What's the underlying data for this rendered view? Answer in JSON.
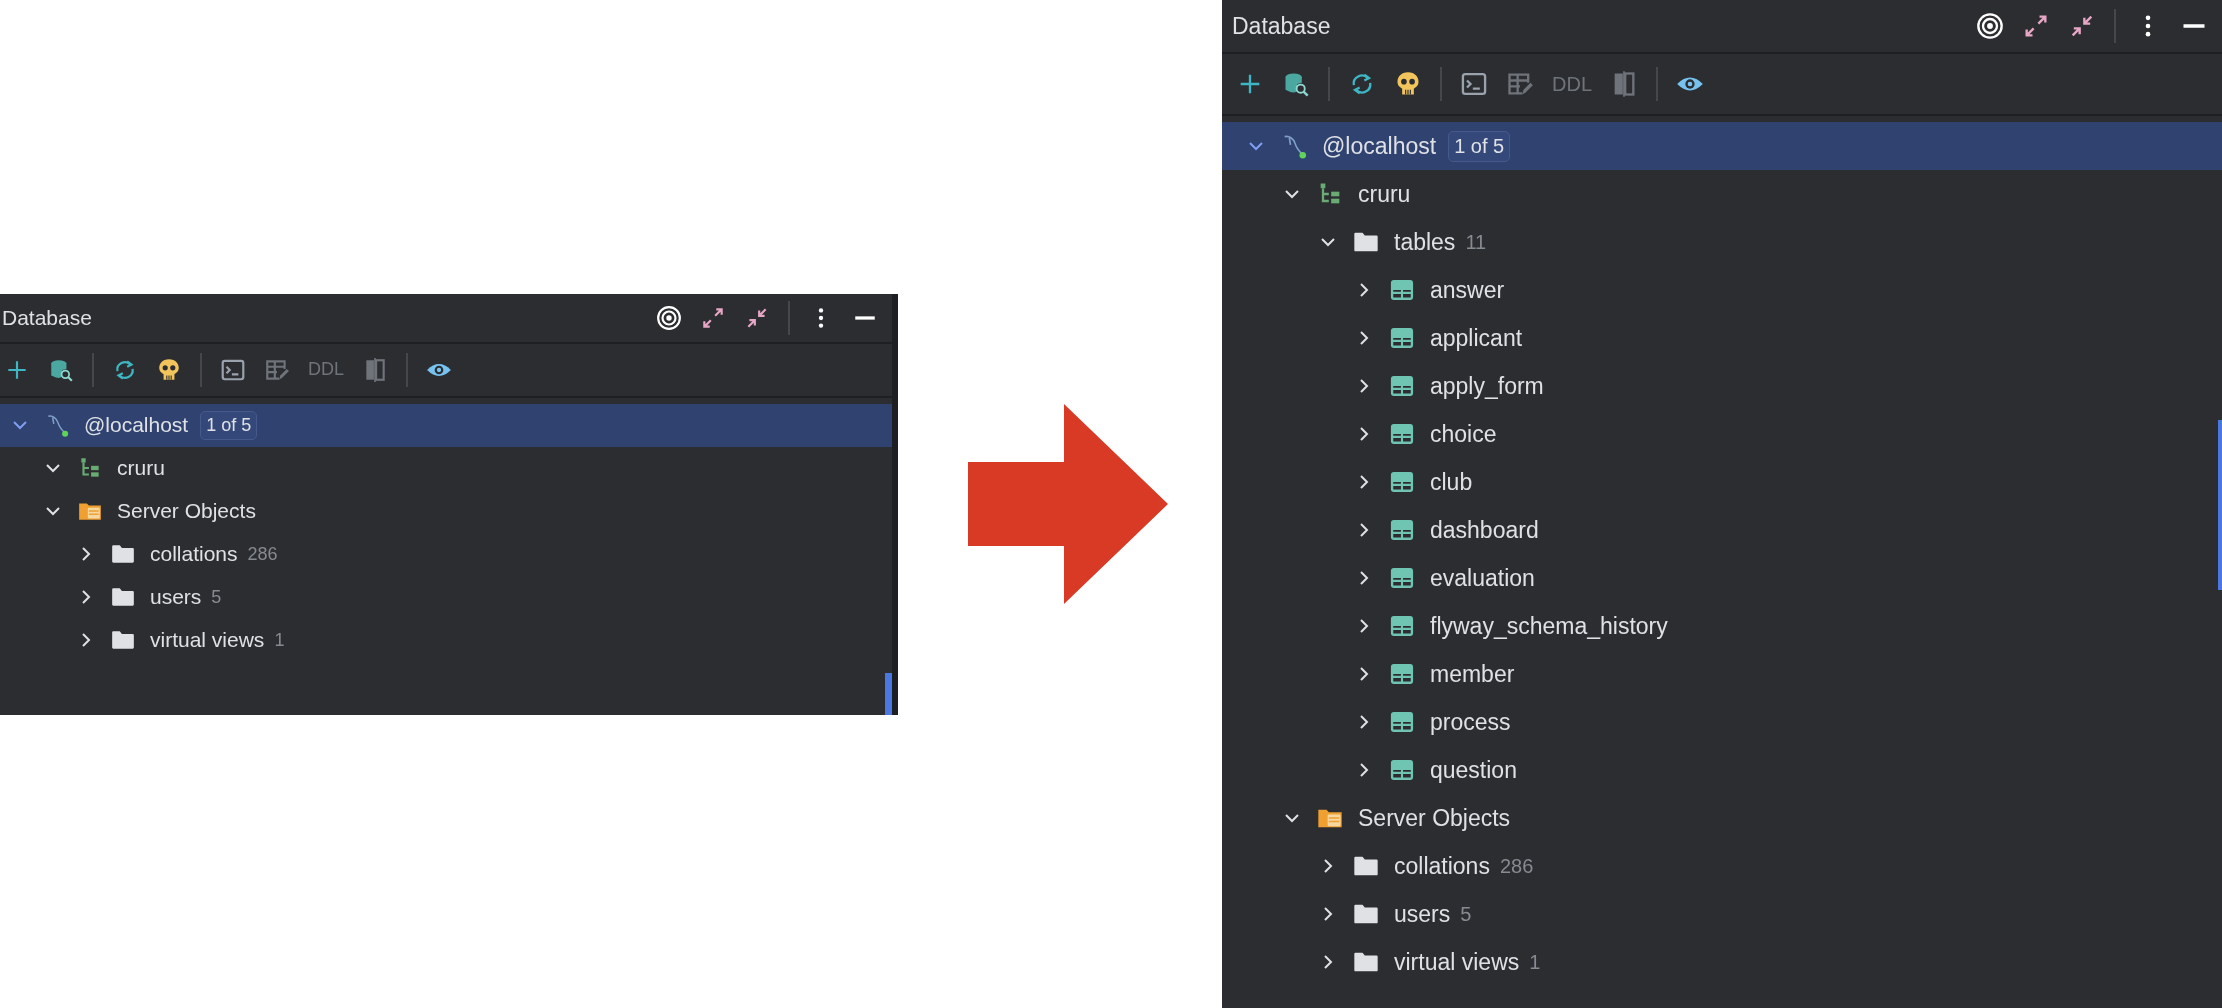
{
  "panels": [
    {
      "title": "Database",
      "ddl": {
        "label": "DDL",
        "disabled": true
      },
      "tree": [
        {
          "kind": "host",
          "label": "@localhost",
          "badge": "1 of 5",
          "expanded": true,
          "selected": true,
          "children": [
            {
              "kind": "schema",
              "label": "cruru",
              "expanded": true,
              "selected": false
            },
            {
              "kind": "server-objects",
              "label": "Server Objects",
              "expanded": true,
              "selected": false,
              "children": [
                {
                  "kind": "folder",
                  "label": "collations",
                  "count": "286",
                  "expanded": false,
                  "selected": false
                },
                {
                  "kind": "folder",
                  "label": "users",
                  "count": "5",
                  "expanded": false,
                  "selected": false
                },
                {
                  "kind": "folder",
                  "label": "virtual views",
                  "count": "1",
                  "expanded": false,
                  "selected": false
                }
              ]
            }
          ]
        }
      ]
    },
    {
      "title": "Database",
      "ddl": {
        "label": "DDL",
        "disabled": true
      },
      "tree": [
        {
          "kind": "host",
          "label": "@localhost",
          "badge": "1 of 5",
          "expanded": true,
          "selected": true,
          "children": [
            {
              "kind": "schema",
              "label": "cruru",
              "expanded": true,
              "selected": false,
              "children": [
                {
                  "kind": "folder",
                  "label": "tables",
                  "count": "11",
                  "expanded": true,
                  "selected": false,
                  "children": [
                    {
                      "kind": "table",
                      "label": "answer",
                      "expanded": false,
                      "selected": false
                    },
                    {
                      "kind": "table",
                      "label": "applicant",
                      "expanded": false,
                      "selected": false
                    },
                    {
                      "kind": "table",
                      "label": "apply_form",
                      "expanded": false,
                      "selected": false
                    },
                    {
                      "kind": "table",
                      "label": "choice",
                      "expanded": false,
                      "selected": false
                    },
                    {
                      "kind": "table",
                      "label": "club",
                      "expanded": false,
                      "selected": false
                    },
                    {
                      "kind": "table",
                      "label": "dashboard",
                      "expanded": false,
                      "selected": false
                    },
                    {
                      "kind": "table",
                      "label": "evaluation",
                      "expanded": false,
                      "selected": false
                    },
                    {
                      "kind": "table",
                      "label": "flyway_schema_history",
                      "expanded": false,
                      "selected": false
                    },
                    {
                      "kind": "table",
                      "label": "member",
                      "expanded": false,
                      "selected": false
                    },
                    {
                      "kind": "table",
                      "label": "process",
                      "expanded": false,
                      "selected": false
                    },
                    {
                      "kind": "table",
                      "label": "question",
                      "expanded": false,
                      "selected": false
                    }
                  ]
                }
              ]
            },
            {
              "kind": "server-objects",
              "label": "Server Objects",
              "expanded": true,
              "selected": false,
              "children": [
                {
                  "kind": "folder",
                  "label": "collations",
                  "count": "286",
                  "expanded": false,
                  "selected": false
                },
                {
                  "kind": "folder",
                  "label": "users",
                  "count": "5",
                  "expanded": false,
                  "selected": false
                },
                {
                  "kind": "folder",
                  "label": "virtual views",
                  "count": "1",
                  "expanded": false,
                  "selected": false
                }
              ]
            }
          ]
        }
      ]
    }
  ]
}
